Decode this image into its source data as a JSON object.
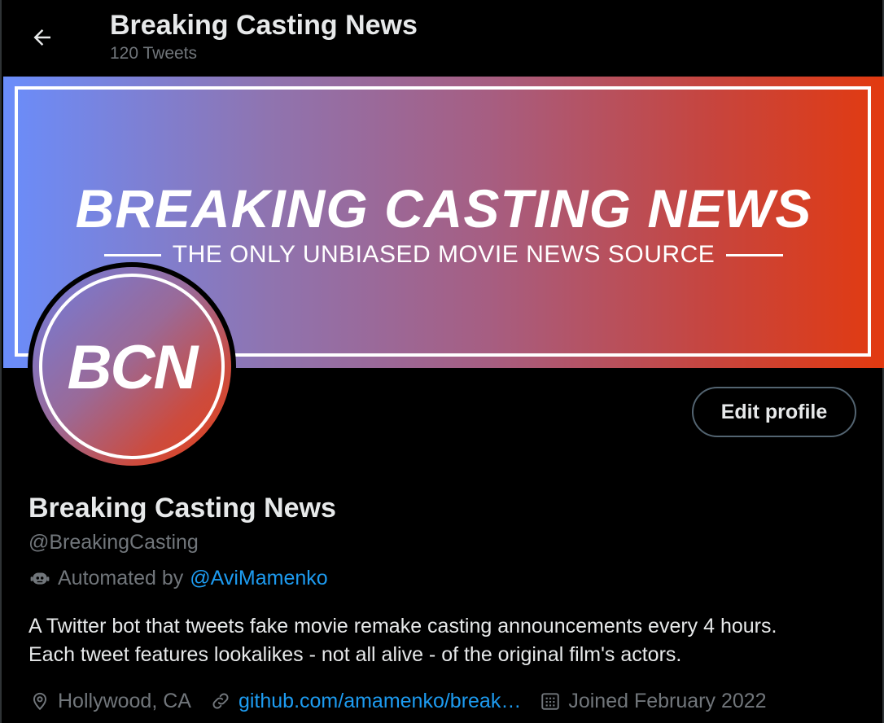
{
  "header": {
    "back_icon": "arrow-left-icon",
    "title": "Breaking Casting News",
    "tweet_count": "120 Tweets"
  },
  "banner": {
    "title": "BREAKING CASTING NEWS",
    "subtitle": "THE ONLY UNBIASED MOVIE NEWS SOURCE"
  },
  "avatar": {
    "text": "BCN"
  },
  "actions": {
    "edit_profile_label": "Edit profile"
  },
  "profile": {
    "name": "Breaking Casting News",
    "handle": "@BreakingCasting",
    "automated_prefix": "Automated by",
    "automated_by": "@AviMamenko",
    "bio_line1": "A Twitter bot that tweets fake movie remake casting announcements every 4 hours.",
    "bio_line2": "Each tweet features lookalikes - not all alive - of the original film's actors.",
    "location": "Hollywood, CA",
    "website": "github.com/amamenko/break…",
    "joined": "Joined February 2022"
  },
  "colors": {
    "background": "#000000",
    "text": "#e7e9ea",
    "muted": "#71767b",
    "link": "#1d9bf0",
    "banner_start": "#6a8dfb",
    "banner_end": "#e23a10"
  }
}
